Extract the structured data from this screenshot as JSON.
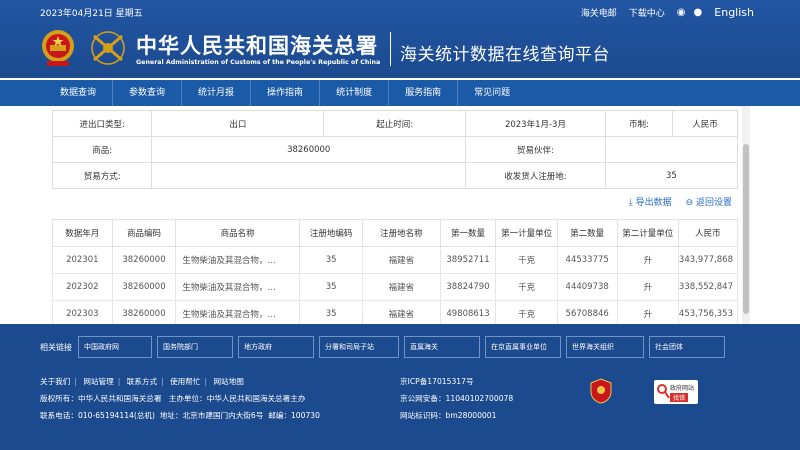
{
  "topbar": {
    "date": "2023年04月21日 星期五",
    "links": [
      "海关电邮",
      "下载中心"
    ],
    "english": "English"
  },
  "brand": {
    "title_zh": "中华人民共和国海关总署",
    "title_en": "General Administration of Customs of the People's Republic of China",
    "platform": "海关统计数据在线查询平台"
  },
  "nav": {
    "items": [
      "数据查询",
      "参数查询",
      "统计月报",
      "操作指南",
      "统计制度",
      "服务指南",
      "常见问题"
    ]
  },
  "query": {
    "rows": [
      [
        {
          "label": "进出口类型:",
          "value": "出口"
        },
        {
          "label": "起止时间:",
          "value": "2023年1月-3月"
        },
        {
          "label": "币制:",
          "value": "人民币"
        }
      ],
      [
        {
          "label": "商品:",
          "value": "38260000"
        },
        {
          "label": "贸易伙伴:",
          "value": ""
        }
      ],
      [
        {
          "label": "贸易方式:",
          "value": ""
        },
        {
          "label": "收发货人注册地:",
          "value": "35"
        }
      ]
    ]
  },
  "actions": {
    "export": "导出数据",
    "back": "返回设置"
  },
  "results": {
    "headers": [
      "数据年月",
      "商品编码",
      "商品名称",
      "注册地编码",
      "注册地名称",
      "第一数量",
      "第一计量单位",
      "第二数量",
      "第二计量单位",
      "人民币"
    ],
    "rows": [
      [
        "202301",
        "38260000",
        "生物柴油及其混合物，…",
        "35",
        "福建省",
        "38952711",
        "千克",
        "44533775",
        "升",
        "343,977,868"
      ],
      [
        "202302",
        "38260000",
        "生物柴油及其混合物，…",
        "35",
        "福建省",
        "38824790",
        "千克",
        "44409738",
        "升",
        "338,552,847"
      ],
      [
        "202303",
        "38260000",
        "生物柴油及其混合物，…",
        "35",
        "福建省",
        "49808613",
        "千克",
        "56708846",
        "升",
        "453,756,353"
      ]
    ]
  },
  "footer": {
    "links_label": "相关链接",
    "link_boxes": [
      "中国政府网",
      "国务院部门",
      "地方政府",
      "分署和司局子站",
      "直属海关",
      "在京直属事业单位",
      "世界海关组织",
      "社会团体"
    ],
    "bottom_links": [
      "关于我们",
      "网站管理",
      "联系方式",
      "使用帮忙",
      "网站地图"
    ],
    "copyright": "版权所有：中华人民共和国海关总署",
    "host": "主办单位：中华人民共和国海关总署主办",
    "contact": "联系电话：010-65194114(总机)",
    "address": "地址：北京市建国门内大街6号",
    "zip": "邮编：100730",
    "icp": "京ICP备17015317号",
    "police": "京公网安备：11040102700078",
    "site_code": "网站标识码：bm28000001",
    "badge_text": "政府网站",
    "badge_red": "找错"
  }
}
